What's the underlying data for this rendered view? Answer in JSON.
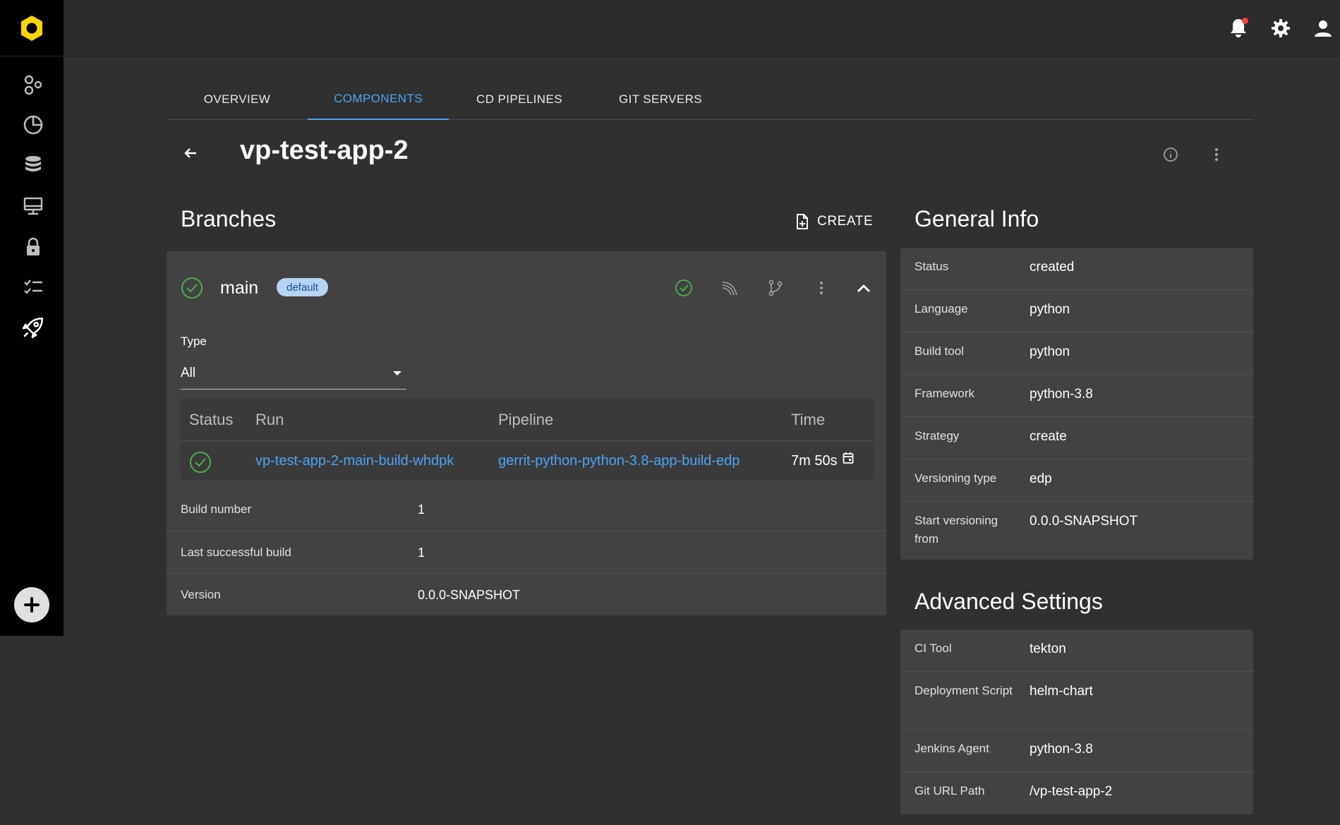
{
  "tabs": [
    {
      "label": "OVERVIEW"
    },
    {
      "label": "COMPONENTS"
    },
    {
      "label": "CD PIPELINES"
    },
    {
      "label": "GIT SERVERS"
    }
  ],
  "active_tab": "COMPONENTS",
  "page": {
    "title": "vp-test-app-2"
  },
  "branches": {
    "title": "Branches",
    "create_label": "CREATE",
    "branch": {
      "name": "main",
      "badge": "default",
      "type_label": "Type",
      "type_value": "All",
      "table": {
        "headers": [
          "Status",
          "Run",
          "Pipeline",
          "Time"
        ],
        "rows": [
          {
            "run": "vp-test-app-2-main-build-whdpk",
            "pipeline": "gerrit-python-python-3.8-app-build-edp",
            "time": "7m 50s"
          }
        ]
      },
      "details": [
        {
          "key": "Build number",
          "value": "1"
        },
        {
          "key": "Last successful build",
          "value": "1"
        },
        {
          "key": "Version",
          "value": "0.0.0-SNAPSHOT"
        }
      ]
    }
  },
  "general_info": {
    "title": "General Info",
    "rows": [
      {
        "key": "Status",
        "value": "created"
      },
      {
        "key": "Language",
        "value": "python"
      },
      {
        "key": "Build tool",
        "value": "python"
      },
      {
        "key": "Framework",
        "value": "python-3.8"
      },
      {
        "key": "Strategy",
        "value": "create"
      },
      {
        "key": "Versioning type",
        "value": "edp"
      },
      {
        "key": "Start versioning from",
        "value": "0.0.0-SNAPSHOT"
      }
    ]
  },
  "advanced_settings": {
    "title": "Advanced Settings",
    "rows": [
      {
        "key": "CI Tool",
        "value": "tekton"
      },
      {
        "key": "Deployment Script",
        "value": "helm-chart"
      },
      {
        "key": "Jenkins Agent",
        "value": "python-3.8"
      },
      {
        "key": "Git URL Path",
        "value": "/vp-test-app-2"
      }
    ]
  },
  "colors": {
    "accent": "#4ba3f5",
    "logo": "#ffd600",
    "success": "#4caf50",
    "notification": "#f44336"
  },
  "icons": {
    "sidebar": [
      "components-icon",
      "dashboard-icon",
      "database-icon",
      "monitor-icon",
      "lock-icon",
      "checklist-icon",
      "rocket-icon"
    ]
  }
}
